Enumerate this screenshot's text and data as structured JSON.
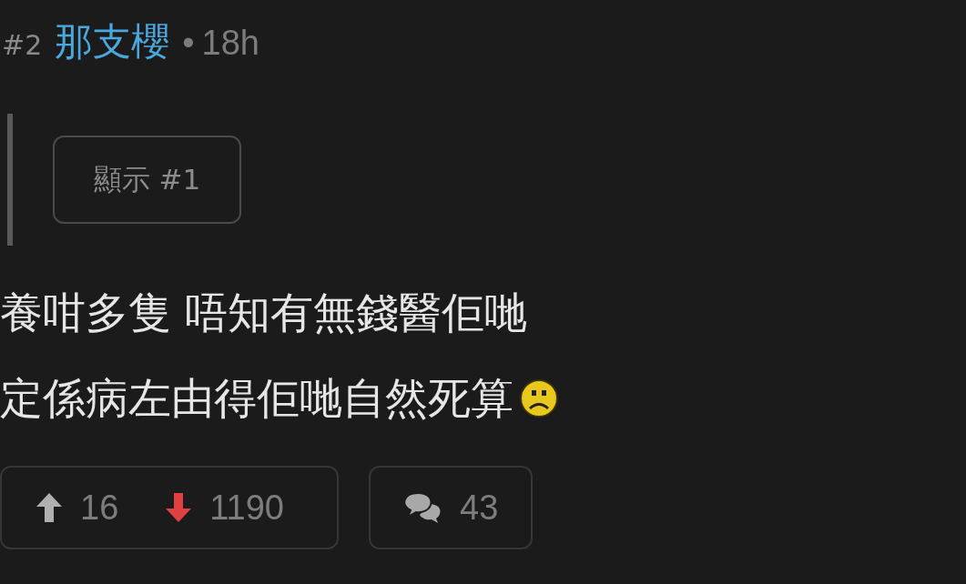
{
  "post": {
    "number": "#2",
    "author": "那支櫻",
    "separator": "•",
    "time": "18h"
  },
  "quote": {
    "button": "顯示 #1"
  },
  "body": [
    "養咁多隻 唔知有無錢醫佢哋",
    "定係病左由得佢哋自然死算"
  ],
  "votes": [
    {
      "kind": "up",
      "count": "16",
      "selected": false
    },
    {
      "kind": "down",
      "count": "1190",
      "selected": true
    }
  ],
  "comments": {
    "count": "43"
  }
}
